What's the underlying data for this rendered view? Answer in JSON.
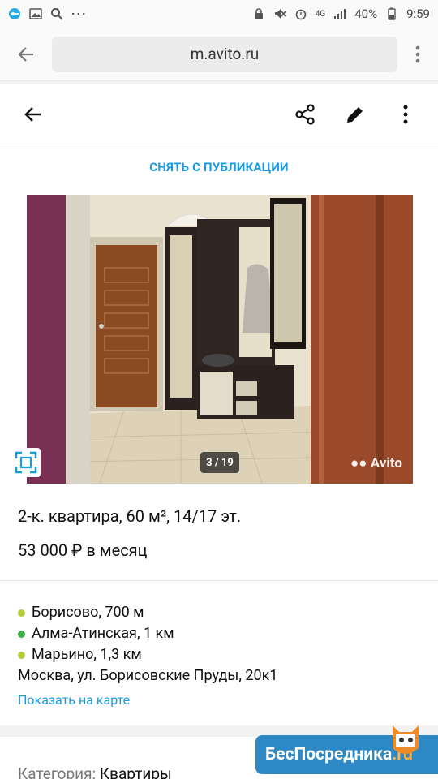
{
  "status": {
    "battery": "40%",
    "time": "9:59",
    "network": "4G"
  },
  "browser": {
    "url": "m.avito.ru"
  },
  "actions": {
    "unpublish": "СНЯТЬ С ПУБЛИКАЦИИ"
  },
  "photo": {
    "counter": "3 / 19",
    "watermark": "Avito"
  },
  "listing": {
    "title": "2-к. квартира, 60 м², 14/17 эт.",
    "price": "53 000 ₽ в месяц",
    "metro": [
      {
        "name": "Борисово, 700 м",
        "color": "#b7cc3c"
      },
      {
        "name": "Алма-Атинская, 1 км",
        "color": "#3fae49"
      },
      {
        "name": "Марьино, 1,3 км",
        "color": "#b7cc3c"
      }
    ],
    "address": "Москва, ул. Борисовские Пруды, 20к1",
    "map_link": "Показать на карте",
    "category_label": "Категория:",
    "category_value": "Квартиры"
  },
  "promo": {
    "text": "БесПосредника",
    "suffix": ".ru"
  }
}
